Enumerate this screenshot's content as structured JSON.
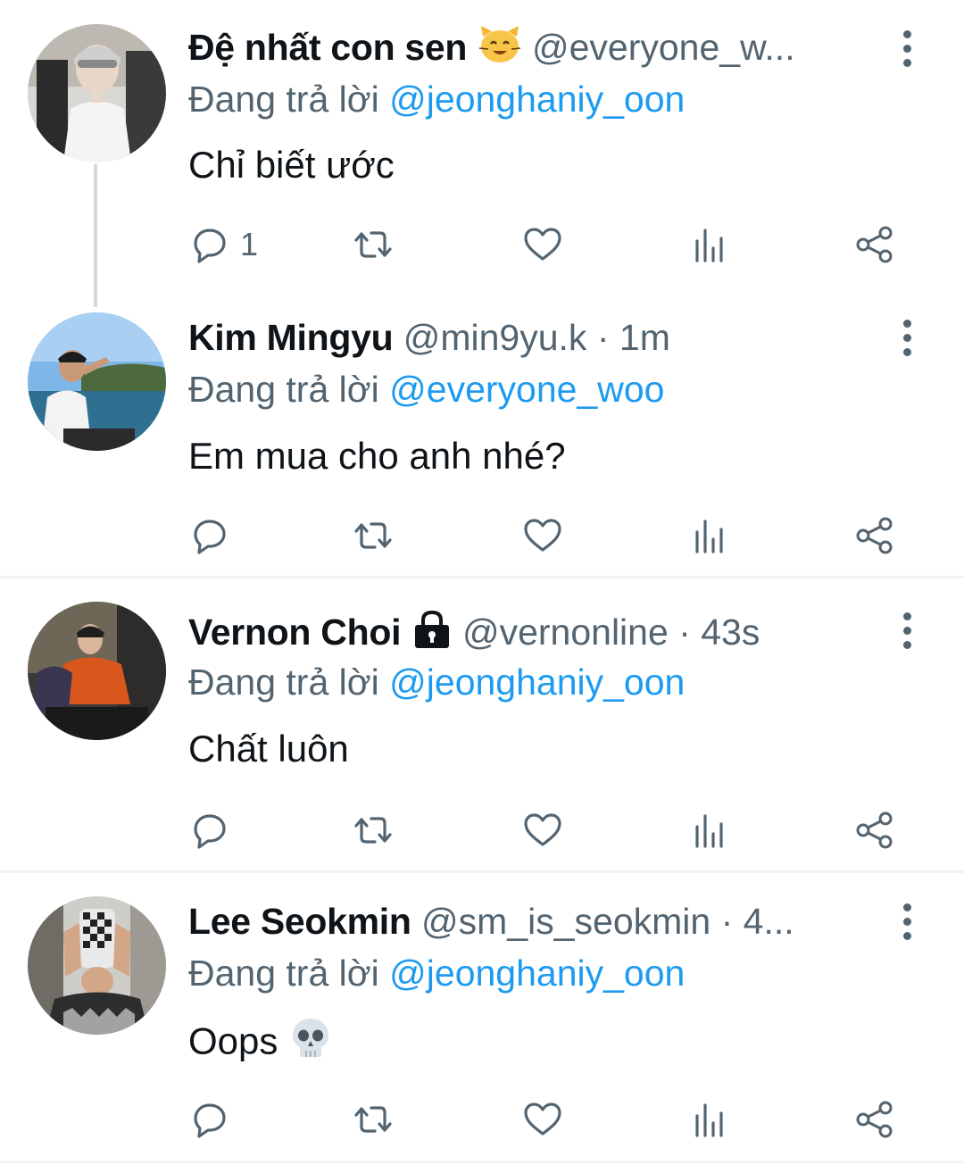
{
  "tweets": [
    {
      "name": "Đệ nhất con sen",
      "name_emoji": "cat-face-emoji",
      "handle": "@everyone_w...",
      "time": "",
      "reply_prefix": "Đang trả lời",
      "reply_to": "@jeonghaniy_oon",
      "text": "Chỉ biết ước",
      "reply_count": "1"
    },
    {
      "name": "Kim Mingyu",
      "handle": "@min9yu.k",
      "dot": "·",
      "time": "1m",
      "reply_prefix": "Đang trả lời",
      "reply_to": "@everyone_woo",
      "text": "Em mua cho anh nhé?",
      "reply_count": ""
    },
    {
      "name": "Vernon Choi",
      "name_icon": "lock-icon",
      "handle": "@vernonline",
      "dot": "·",
      "time": "43s",
      "reply_prefix": "Đang trả lời",
      "reply_to": "@jeonghaniy_oon",
      "text": "Chất luôn",
      "reply_count": ""
    },
    {
      "name": "Lee Seokmin",
      "handle": "@sm_is_seokmin",
      "dot": "·",
      "time": "4...",
      "reply_prefix": "Đang trả lời",
      "reply_to": "@jeonghaniy_oon",
      "text": "Oops",
      "text_emoji": "skull-emoji",
      "reply_count": ""
    }
  ],
  "colors": {
    "text": "#0f1419",
    "secondary": "#536471",
    "link": "#1d9bf0",
    "divider": "#eff3f4",
    "thread_line": "#cfd9de"
  },
  "icons": [
    "reply-icon",
    "retweet-icon",
    "like-icon",
    "views-icon",
    "share-icon",
    "more-icon"
  ]
}
